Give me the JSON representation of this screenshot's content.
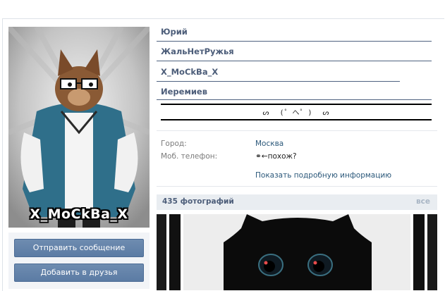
{
  "profile": {
    "avatar_caption": "X_MoCkBa_X"
  },
  "actions": {
    "send_message": "Отправить сообщение",
    "add_friend": "Добавить в друзья"
  },
  "name_lines": [
    "Юрий",
    "ЖальНетРужья",
    "X_MoCkBa_X",
    "Иеремиев"
  ],
  "emoticons": "ᔕ  (゜へ゜)  ᔕ",
  "info": {
    "city_label": "Город:",
    "city_value": "Москва",
    "phone_label": "Моб. телефон:",
    "phone_value": "⚭←похож?",
    "more_link": "Показать подробную информацию"
  },
  "photos": {
    "title": "435 фотографий",
    "all_link": "все"
  },
  "colors": {
    "link": "#2b587a",
    "name": "#4c5d79",
    "button": "#5e7fa8",
    "header_bg": "#e9edf1"
  }
}
